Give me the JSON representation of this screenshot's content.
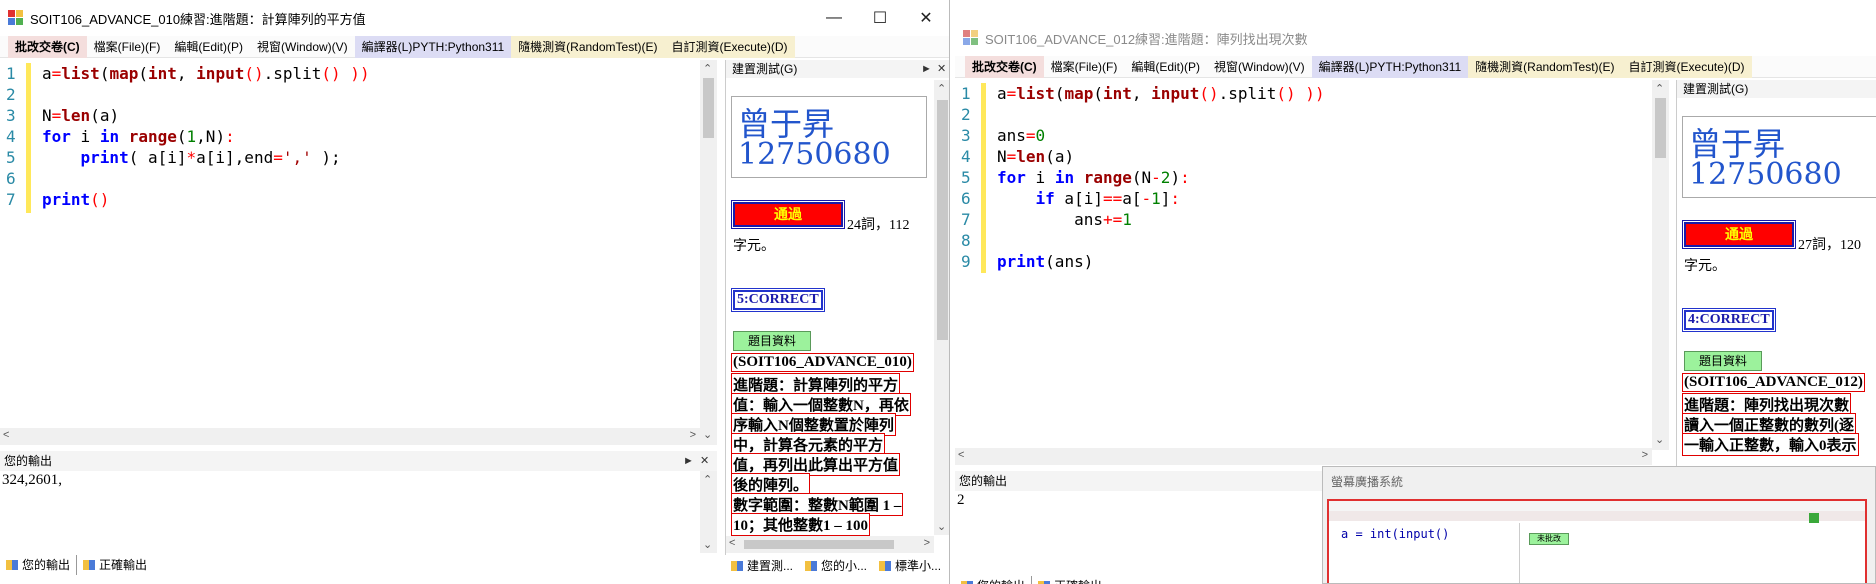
{
  "left": {
    "title": "SOIT106_ADVANCE_010練習:進階題：計算陣列的平方值",
    "menu": [
      "批改交卷(C)",
      "檔案(File)(F)",
      "編輯(Edit)(P)",
      "視窗(Window)(V)",
      "編譯器(L)PYTH:Python311",
      "隨機測資(RandomTest)(E)",
      "自訂測資(Execute)(D)"
    ],
    "code": {
      "line1": "a=list(map(int, input().split() ))",
      "line3": "N=len(a)",
      "line4": "for i in range(1,N):",
      "line5": "    print( a[i]*a[i],end=',' );",
      "line7": "print()"
    },
    "line_numbers": [
      "1",
      "2",
      "3",
      "4",
      "5",
      "6",
      "7"
    ],
    "output_title": "您的輸出",
    "output_value": "324,2601,",
    "tabs": [
      "您的輸出",
      "正確輸出"
    ],
    "side": {
      "header": "建置測試(G)",
      "name": "曾于昇",
      "id": "12750680",
      "pass_label": "通過",
      "stat": "24詞，112",
      "stat2": "字元。",
      "correct": "5:CORRECT",
      "info_btn": "題目資料",
      "desc": [
        "(SOIT106_ADVANCE_010)",
        "進階題：計算陣列的平方",
        "值：輸入一個整數N，再依",
        "序輸入N個整數置於陣列",
        "中，計算各元素的平方",
        "值，再列出此算出平方值",
        "後的陣列。",
        "數字範圍：整數N範圍 1 –",
        "10；其他整數1 – 100"
      ],
      "tabs": [
        "建置測...",
        "您的小...",
        "標準小..."
      ]
    }
  },
  "right": {
    "title": "SOIT106_ADVANCE_012練習:進階題：陣列找出現次數",
    "menu": [
      "批改交卷(C)",
      "檔案(File)(F)",
      "編輯(Edit)(P)",
      "視窗(Window)(V)",
      "編譯器(L)PYTH:Python311",
      "隨機測資(RandomTest)(E)",
      "自訂測資(Execute)(D)"
    ],
    "line_numbers": [
      "1",
      "2",
      "3",
      "4",
      "5",
      "6",
      "7",
      "8",
      "9"
    ],
    "output_title": "您的輸出",
    "output_value": "2",
    "tabs": [
      "您的輸出",
      "正確輸出"
    ],
    "side": {
      "header": "建置測試(G)",
      "name": "曾于昇",
      "id": "12750680",
      "pass_label": "通過",
      "stat": "27詞，120",
      "stat2": "字元。",
      "correct": "4:CORRECT",
      "info_btn": "題目資料",
      "desc": [
        "(SOIT106_ADVANCE_012)",
        "進階題：陣列找出現次數",
        "讀入一個正整數的數列(逐",
        "一輸入正整數，輸入0表示"
      ]
    }
  },
  "popup": {
    "title": "螢幕廣播系統",
    "mini_code": "a = int(input()",
    "mini_btn": "未批改"
  },
  "colors": {
    "pass_bg": "#ff0000",
    "pass_text": "#ffff00",
    "correct_border": "#2233cc"
  }
}
